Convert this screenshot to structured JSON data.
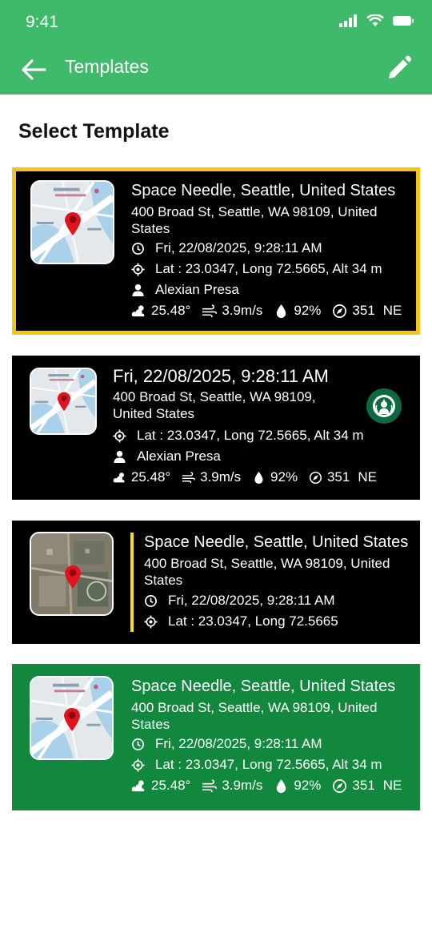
{
  "status_bar": {
    "time": "9:41"
  },
  "app_bar": {
    "title": "Templates"
  },
  "heading": "Select Template",
  "templates": [
    {
      "place": "Space Needle, Seattle, United States",
      "address": "400 Broad St, Seattle, WA 98109, United States",
      "datetime": "Fri, 22/08/2025, 9:28:11 AM",
      "coords": "Lat : 23.0347, Long 72.5665, Alt 34 m",
      "user": "Alexian Presa",
      "temperature": "25.48°",
      "wind": "3.9m/s",
      "humidity": "92%",
      "heading": "351",
      "direction": "NE",
      "selected": true,
      "border_color": "#f6c416"
    },
    {
      "datetime": "Fri, 22/08/2025, 9:28:11 AM",
      "address": "400 Broad St, Seattle, WA 98109, United States",
      "coords": "Lat : 23.0347, Long 72.5665, Alt 34 m",
      "user": "Alexian Presa",
      "temperature": "25.48°",
      "wind": "3.9m/s",
      "humidity": "92%",
      "heading": "351",
      "direction": "NE",
      "logo": "starbucks-logo"
    },
    {
      "place": "Space Needle, Seattle, United States",
      "address": "400 Broad St, Seattle, WA 98109, United States",
      "datetime": "Fri, 22/08/2025, 9:28:11 AM",
      "coords": "Lat : 23.0347, Long 72.5665",
      "accent_color": "#f6e016"
    },
    {
      "place": "Space Needle, Seattle, United States",
      "address": "400 Broad St, Seattle, WA 98109, United States",
      "datetime": "Fri, 22/08/2025, 9:28:11 AM",
      "coords": "Lat : 23.0347, Long 72.5665, Alt 34 m",
      "temperature": "25.48°",
      "wind": "3.9m/s",
      "humidity": "92%",
      "heading": "351",
      "direction": "NE",
      "background": "#12883f"
    }
  ],
  "colors": {
    "brand_green": "#3fb96a",
    "selected_border": "#f6c416",
    "card_dark": "#000000",
    "card_green": "#12883f"
  },
  "icons": [
    "back-arrow-icon",
    "edit-pencil-icon",
    "clock-icon",
    "location-target-icon",
    "person-icon",
    "weather-icon",
    "wind-icon",
    "humidity-drop-icon",
    "compass-icon",
    "map-pin-icon"
  ]
}
